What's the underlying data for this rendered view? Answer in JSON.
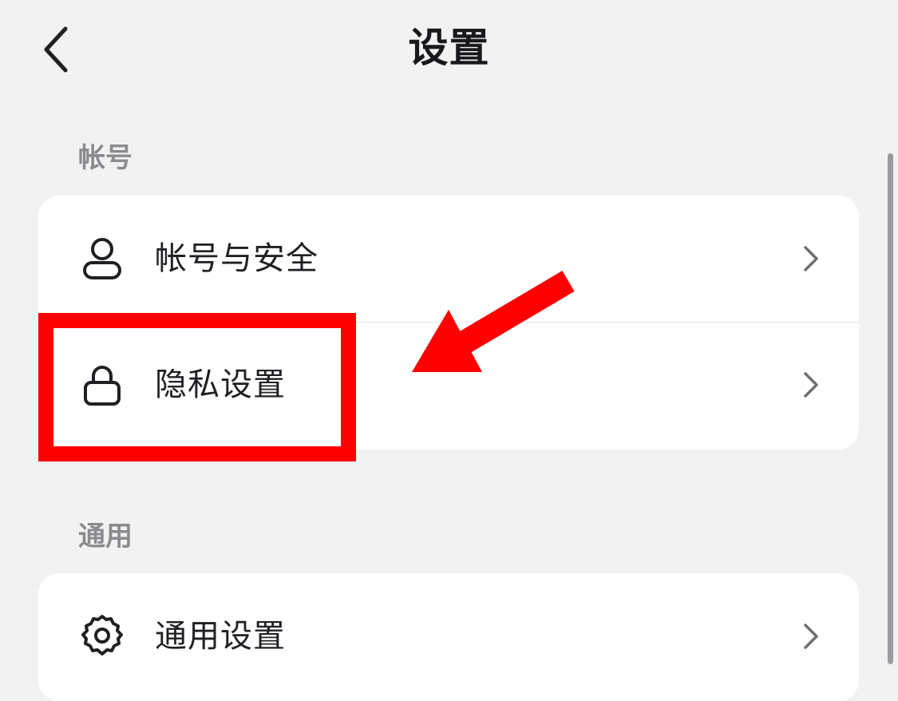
{
  "header": {
    "title": "设置"
  },
  "sections": [
    {
      "label": "帐号",
      "items": [
        {
          "label": "帐号与安全",
          "icon": "user-icon"
        },
        {
          "label": "隐私设置",
          "icon": "lock-icon"
        }
      ]
    },
    {
      "label": "通用",
      "items": [
        {
          "label": "通用设置",
          "icon": "gear-icon"
        }
      ]
    }
  ],
  "annotation": {
    "highlight_color": "#ff0000",
    "target": "隐私设置"
  }
}
